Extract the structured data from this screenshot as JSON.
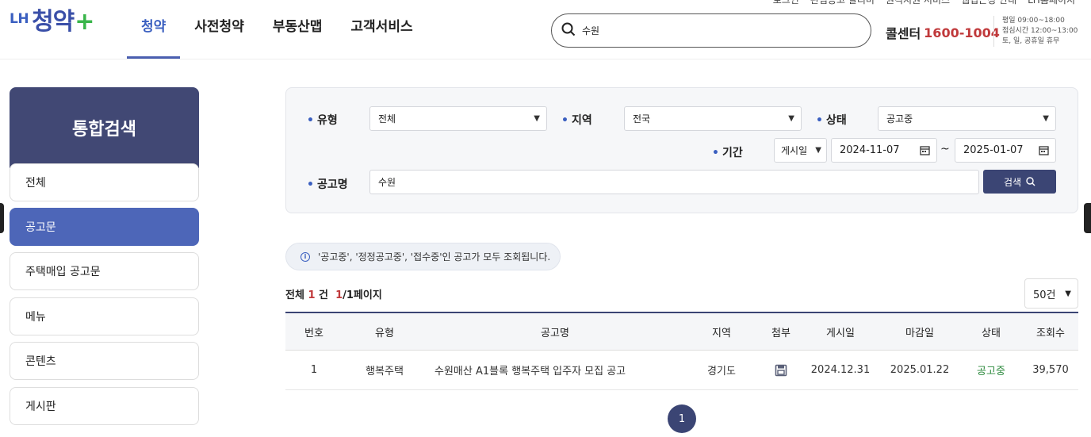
{
  "header": {
    "logo_prefix": "LH",
    "logo_main": "청약",
    "logo_plus": "+",
    "nav": [
      "청약",
      "사전청약",
      "부동산맵",
      "고객서비스"
    ],
    "util_links": [
      "로그인",
      "관심공고 알리미",
      "원격지원 서비스",
      "웹접근성 안내",
      "LH홈페이지"
    ],
    "search_value": "수원",
    "call_label": "콜센터",
    "call_number": "1600-1004",
    "call_hours": [
      "평일 09:00~18:00",
      "점심시간 12:00~13:00",
      "토, 일, 공휴일 휴무"
    ]
  },
  "sidebar": {
    "title": "통합검색",
    "items": [
      "전체",
      "공고문",
      "주택매입 공고문",
      "메뉴",
      "콘텐츠",
      "게시판"
    ],
    "active_index": 1
  },
  "filter": {
    "type_label": "유형",
    "type_value": "전체",
    "region_label": "지역",
    "region_value": "전국",
    "status_label": "상태",
    "status_value": "공고중",
    "period_label": "기간",
    "period_type": "게시일",
    "date_from": "2024-11-07",
    "date_sep": "~",
    "date_to": "2025-01-07",
    "name_label": "공고명",
    "name_value": "수원",
    "search_button": "검색"
  },
  "notice": "'공고중', '정정공고중', '접수중'인 공고가 모두 조회됩니다.",
  "summary": {
    "prefix": "전체",
    "total": "1",
    "unit": "건",
    "page_current": "1",
    "page_rest": "/1페이지"
  },
  "page_size": "50건",
  "table": {
    "columns": [
      "번호",
      "유형",
      "공고명",
      "지역",
      "첨부",
      "게시일",
      "마감일",
      "상태",
      "조회수"
    ],
    "rows": [
      {
        "no": "1",
        "type": "행복주택",
        "title": "수원매산 A1블록 행복주택 입주자 모집 공고",
        "region": "경기도",
        "attach_icon": "file-icon",
        "posted": "2024.12.31",
        "deadline": "2025.01.22",
        "status": "공고중",
        "views": "39,570"
      }
    ]
  },
  "pagination": [
    "1"
  ],
  "colors": {
    "brand": "#3a4fa8",
    "accent": "#c0393b",
    "active_status": "#2d8a3e",
    "dark_button": "#3b4574"
  }
}
